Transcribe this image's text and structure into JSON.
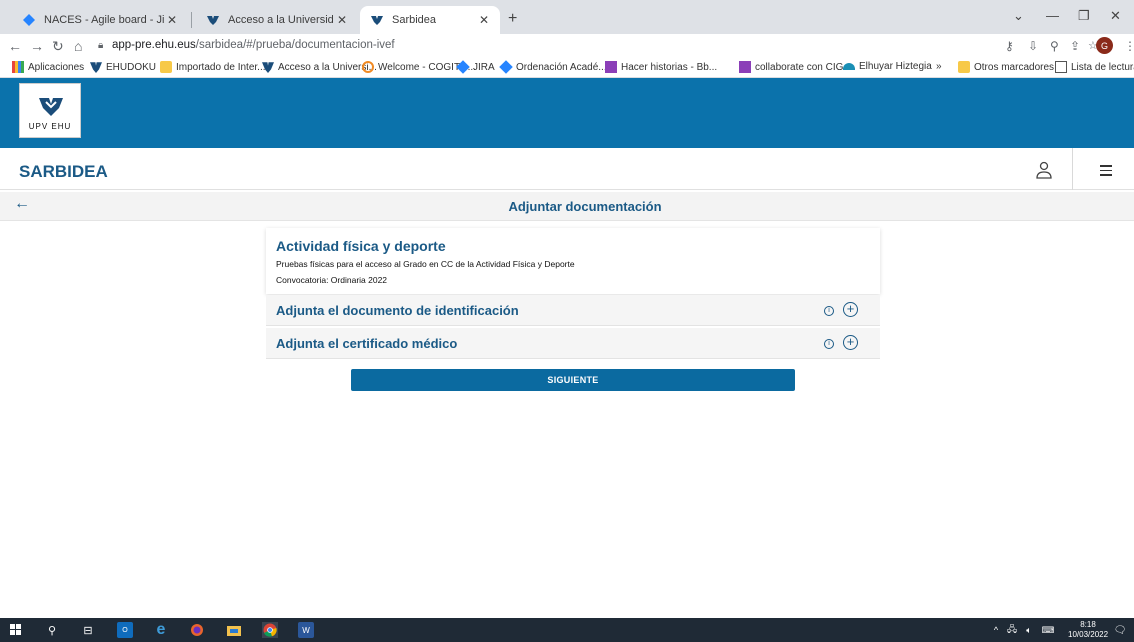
{
  "browser": {
    "tabs": [
      {
        "title": "NACES - Agile board - Jira",
        "active": false
      },
      {
        "title": "Acceso a la Universidad - UPV/EH",
        "active": false
      },
      {
        "title": "Sarbidea",
        "active": true
      }
    ],
    "url_host": "app-pre.ehu.eus",
    "url_path": "/sarbidea/#/prueba/documentacion-ivef",
    "profile_initial": "G",
    "bookmarks": [
      "Aplicaciones",
      "EHUDOKU",
      "Importado de Inter...",
      "Acceso a la Universi...",
      "Welcome - COGITO...",
      "JIRA",
      "Ordenación Acadé...",
      "Hacer historias - Bb...",
      "collaborate con CIG",
      "Elhuyar Hiztegia",
      "»",
      "Otros marcadores",
      "Lista de lectura"
    ]
  },
  "site": {
    "logo_text": "UPV  EHU",
    "app_title": "SARBIDEA",
    "page_title": "Adjuntar documentación"
  },
  "card": {
    "title": "Actividad física y deporte",
    "line1": "Pruebas físicas para el acceso al Grado en CC de la Actividad Física y Deporte",
    "line2": "Convocatoria: Ordinaria 2022"
  },
  "accordions": [
    {
      "label": "Adjunta el documento de identificación"
    },
    {
      "label": "Adjunta el certificado médico"
    }
  ],
  "next_button": "SIGUIENTE",
  "taskbar": {
    "time": "8:18",
    "date": "10/03/2022"
  },
  "colors": {
    "brand_blue": "#0b72ab",
    "title_blue": "#1b5a86",
    "button_blue": "#0b6aa0"
  }
}
